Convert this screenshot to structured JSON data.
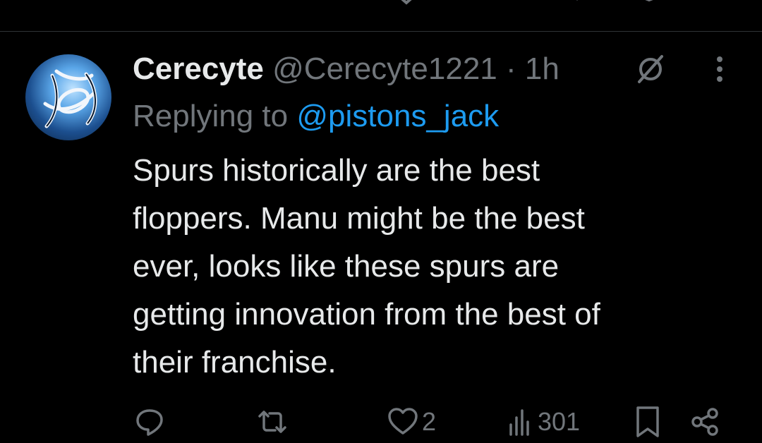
{
  "colors": {
    "background": "#000000",
    "text_primary": "#e7e9ea",
    "text_secondary": "#71767b",
    "accent": "#1d9bf0",
    "divider": "#2f3336"
  },
  "previous_post": {
    "actions": [
      "reply-icon",
      "repost-icon",
      "like-icon",
      "views-icon",
      "bookmark-icon",
      "share-icon"
    ]
  },
  "tweet": {
    "display_name": "Cerecyte",
    "handle": "@Cerecyte1221",
    "separator": "·",
    "time": "1h",
    "replying_prefix": "Replying to",
    "replying_to": "@pistons_jack",
    "text": "Spurs historically are the best\nfloppers. Manu might be the best\never, looks like these spurs are\ngetting innovation from the best of\ntheir franchise.",
    "icons": {
      "avatar": "avatar",
      "grok": "grok-icon",
      "more": "more-icon"
    },
    "actions": {
      "reply_icon": "reply-icon",
      "repost_icon": "repost-icon",
      "like_icon": "heart-icon",
      "like_count": "2",
      "views_icon": "views-icon",
      "views_count": "301",
      "bookmark_icon": "bookmark-icon",
      "share_icon": "share-icon"
    }
  }
}
